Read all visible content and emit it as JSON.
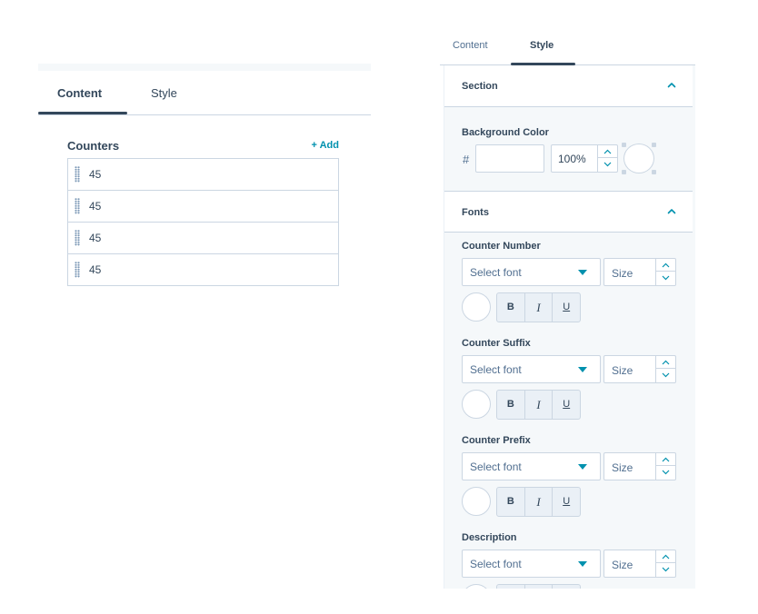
{
  "left": {
    "tabs": [
      {
        "label": "Content",
        "active": true
      },
      {
        "label": "Style",
        "active": false
      }
    ],
    "counters": {
      "title": "Counters",
      "add_label": "+ Add",
      "items": [
        {
          "value": "45"
        },
        {
          "value": "45"
        },
        {
          "value": "45"
        },
        {
          "value": "45"
        }
      ]
    }
  },
  "right": {
    "tabs": [
      {
        "label": "Content",
        "active": false
      },
      {
        "label": "Style",
        "active": true
      }
    ],
    "sections": {
      "section": {
        "label": "Section",
        "expanded": true
      },
      "fonts": {
        "label": "Fonts",
        "expanded": true
      }
    },
    "background_color": {
      "label": "Background Color",
      "hash": "#",
      "hex_value": "",
      "opacity": "100%",
      "swatch_color": "#ffffff"
    },
    "font_groups": [
      {
        "label": "Counter Number",
        "font_placeholder": "Select font",
        "size_placeholder": "Size",
        "bold": "B",
        "italic": "I",
        "underline": "U"
      },
      {
        "label": "Counter Suffix",
        "font_placeholder": "Select font",
        "size_placeholder": "Size",
        "bold": "B",
        "italic": "I",
        "underline": "U"
      },
      {
        "label": "Counter Prefix",
        "font_placeholder": "Select font",
        "size_placeholder": "Size",
        "bold": "B",
        "italic": "I",
        "underline": "U"
      },
      {
        "label": "Description",
        "font_placeholder": "Select font",
        "size_placeholder": "Size",
        "bold": "B",
        "italic": "I",
        "underline": "U"
      }
    ]
  },
  "colors": {
    "accent": "#0091ae",
    "text": "#33475b",
    "border": "#cbd6e2",
    "panel_bg": "#f5f8fa"
  },
  "icons": [
    "drag-handle-icon",
    "chevron-up-icon",
    "caret-down-icon",
    "spinner-up-icon",
    "spinner-down-icon"
  ]
}
